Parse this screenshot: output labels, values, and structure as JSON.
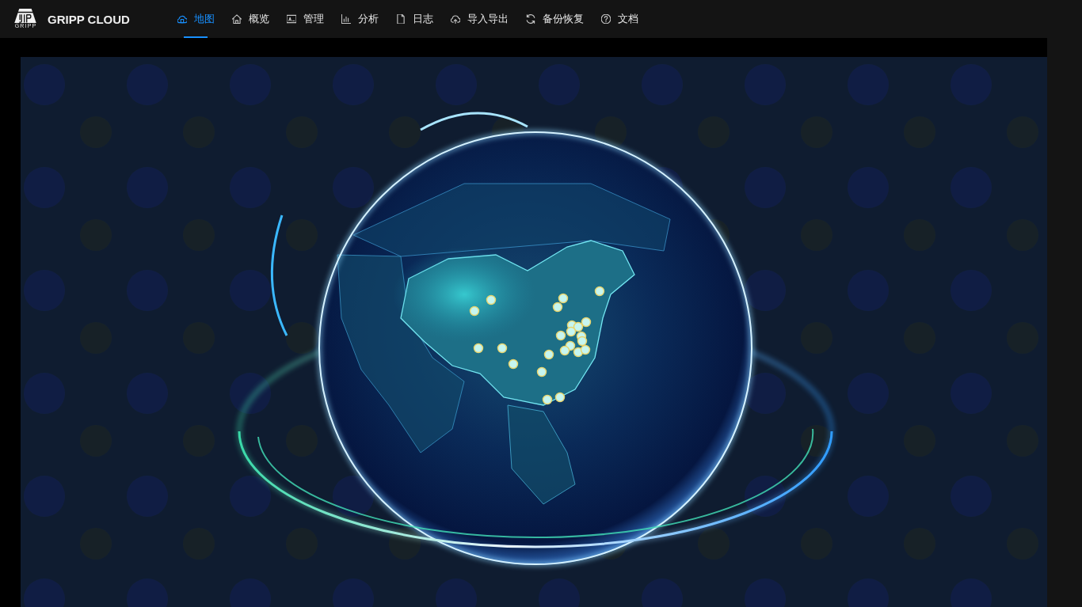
{
  "header": {
    "logo": {
      "caption": "GRIPP"
    },
    "title": "GRIPP CLOUD",
    "nav": [
      {
        "label": "地图",
        "selected": true
      },
      {
        "label": "概览",
        "selected": false
      },
      {
        "label": "管理",
        "selected": false
      },
      {
        "label": "分析",
        "selected": false
      },
      {
        "label": "日志",
        "selected": false
      },
      {
        "label": "导入导出",
        "selected": false
      },
      {
        "label": "备份恢复",
        "selected": false
      },
      {
        "label": "文档",
        "selected": false
      }
    ]
  }
}
